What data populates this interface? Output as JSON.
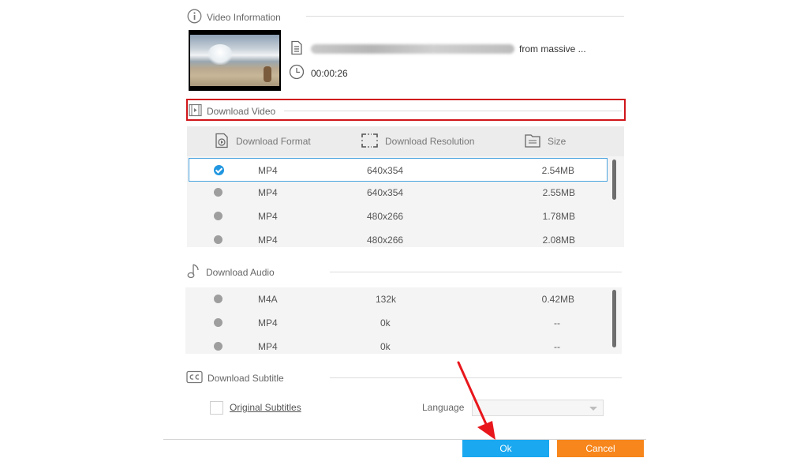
{
  "video_info": {
    "section_label": "Video Information",
    "title_suffix": "from massive ...",
    "duration": "00:00:26"
  },
  "download_video": {
    "section_label": "Download Video",
    "headers": {
      "format": "Download Format",
      "resolution": "Download Resolution",
      "size": "Size"
    },
    "rows": [
      {
        "format": "MP4",
        "resolution": "640x354",
        "size": "2.54MB",
        "selected": true
      },
      {
        "format": "MP4",
        "resolution": "640x354",
        "size": "2.55MB",
        "selected": false
      },
      {
        "format": "MP4",
        "resolution": "480x266",
        "size": "1.78MB",
        "selected": false
      },
      {
        "format": "MP4",
        "resolution": "480x266",
        "size": "2.08MB",
        "selected": false
      }
    ]
  },
  "download_audio": {
    "section_label": "Download Audio",
    "rows": [
      {
        "format": "M4A",
        "bitrate": "132k",
        "size": "0.42MB"
      },
      {
        "format": "MP4",
        "bitrate": "0k",
        "size": "--"
      },
      {
        "format": "MP4",
        "bitrate": "0k",
        "size": "--"
      }
    ]
  },
  "download_subtitle": {
    "section_label": "Download Subtitle",
    "option_label": "Original Subtitles",
    "language_label": "Language",
    "language_value": ""
  },
  "buttons": {
    "ok": "Ok",
    "cancel": "Cancel"
  },
  "colors": {
    "accent_blue": "#1aa8f0",
    "cancel_orange": "#f7861c",
    "highlight_red": "#d0161b",
    "selected_border": "#4aa3df"
  },
  "icons": {
    "video_info": "info-circle-icon",
    "file": "document-icon",
    "duration": "clock-icon",
    "download_video": "film-strip-icon",
    "format": "play-file-icon",
    "resolution": "expand-frame-icon",
    "size": "folder-icon",
    "download_audio": "music-note-icon",
    "download_subtitle": "closed-caption-icon"
  }
}
